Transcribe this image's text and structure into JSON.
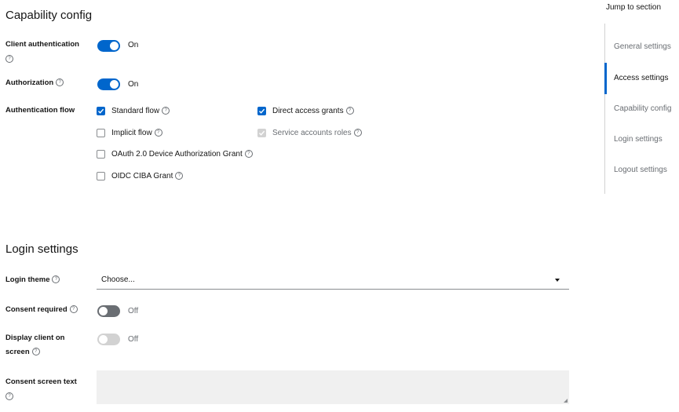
{
  "capability": {
    "title": "Capability config",
    "client_auth": {
      "label": "Client authentication",
      "state": "On"
    },
    "authorization": {
      "label": "Authorization",
      "state": "On"
    },
    "auth_flow": {
      "label": "Authentication flow",
      "options": [
        {
          "label": "Standard flow",
          "checked": true
        },
        {
          "label": "Direct access grants",
          "checked": true
        },
        {
          "label": "Implicit flow",
          "checked": false
        },
        {
          "label": "Service accounts roles",
          "checked": true,
          "disabled": true
        },
        {
          "label": "OAuth 2.0 Device Authorization Grant",
          "checked": false
        },
        {
          "label": "OIDC CIBA Grant",
          "checked": false
        }
      ]
    }
  },
  "login": {
    "title": "Login settings",
    "theme": {
      "label": "Login theme",
      "value": "Choose..."
    },
    "consent_required": {
      "label": "Consent required",
      "state": "Off"
    },
    "display_client": {
      "label_line1": "Display client on",
      "label_line2": "screen",
      "state": "Off"
    },
    "consent_text": {
      "label": "Consent screen text",
      "value": ""
    }
  },
  "jump": {
    "title": "Jump to section",
    "items": [
      {
        "label": "General settings",
        "active": false
      },
      {
        "label": "Access settings",
        "active": true
      },
      {
        "label": "Capability config",
        "active": false
      },
      {
        "label": "Login settings",
        "active": false
      },
      {
        "label": "Logout settings",
        "active": false
      }
    ]
  },
  "colors": {
    "accent": "#0066cc",
    "toggle_off": "#6a6e73",
    "disabled": "#d2d2d2"
  },
  "icons": {
    "help": "help-circle-icon",
    "check": "check-icon",
    "caret": "caret-down-icon"
  }
}
